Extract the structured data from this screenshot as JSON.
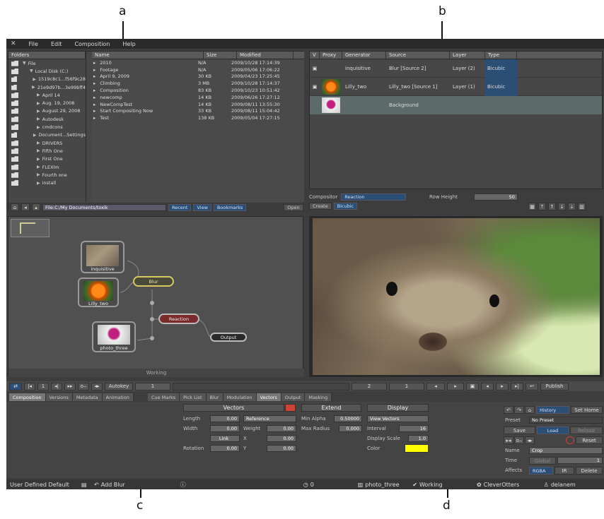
{
  "callouts": {
    "a": "a",
    "b": "b",
    "c": "c",
    "d": "d"
  },
  "menu": [
    "File",
    "Edit",
    "Composition",
    "Help"
  ],
  "browser": {
    "folders_header": "Folders",
    "tree": [
      {
        "label": "File",
        "d": 0,
        "exp": true
      },
      {
        "label": "Local Disk (C:)",
        "d": 1,
        "exp": true
      },
      {
        "label": "1519c8c1...f56f9c28",
        "d": 2
      },
      {
        "label": "21e9d97b...3e99bff4",
        "d": 2
      },
      {
        "label": "April 14",
        "d": 2
      },
      {
        "label": "Aug. 19, 2008",
        "d": 2
      },
      {
        "label": "August 29, 2008",
        "d": 2
      },
      {
        "label": "Autodesk",
        "d": 2
      },
      {
        "label": "cmdcons",
        "d": 2
      },
      {
        "label": "Document...Settings",
        "d": 2
      },
      {
        "label": "DRIVERS",
        "d": 2
      },
      {
        "label": "Fifth One",
        "d": 2
      },
      {
        "label": "First One",
        "d": 2
      },
      {
        "label": "FLEXlm",
        "d": 2
      },
      {
        "label": "Fourth one",
        "d": 2
      },
      {
        "label": "install",
        "d": 2
      }
    ],
    "cols": [
      "Name",
      "Size",
      "Modified"
    ],
    "files": [
      {
        "name": "2010",
        "size": "N/A",
        "mod": "2009/10/28 17:14:39"
      },
      {
        "name": "Footage",
        "size": "N/A",
        "mod": "2009/05/06 17:06:22"
      },
      {
        "name": "April 9, 2009",
        "size": "30 KB",
        "mod": "2009/04/23 17:25:45"
      },
      {
        "name": "Climbing",
        "size": "3 MB",
        "mod": "2009/10/28 17:14:37"
      },
      {
        "name": "Composition",
        "size": "83 KB",
        "mod": "2009/10/23 10:51:42"
      },
      {
        "name": "newcomp",
        "size": "14 KB",
        "mod": "2009/06/26 17:27:12"
      },
      {
        "name": "NewCompTest",
        "size": "14 KB",
        "mod": "2009/08/11 13:55:30"
      },
      {
        "name": "Start Compositing Now",
        "size": "33 KB",
        "mod": "2009/08/11 15:04:42"
      },
      {
        "name": "Test",
        "size": "138 KB",
        "mod": "2009/05/04 17:27:15"
      }
    ],
    "path": "File:C:/My Documents/toxik",
    "recent": "Recent",
    "view": "View",
    "bookmarks": "Bookmarks",
    "open": "Open"
  },
  "layers": {
    "cols": [
      "V",
      "Proxy",
      "Generator",
      "Source",
      "Layer",
      "Type"
    ],
    "rows": [
      {
        "gen": "inquisitive",
        "src": "Blur [Source 2]",
        "layer": "Layer (2)",
        "type": "Bicubic"
      },
      {
        "gen": "Lilly_two",
        "src": "Lilly_two [Source 1]",
        "layer": "Layer (1)",
        "type": "Bicubic"
      },
      {
        "gen": "",
        "src": "Background",
        "layer": "",
        "type": ""
      }
    ],
    "compositor_label": "Compositor",
    "compositor_value": "Reaction",
    "rowheight_label": "Row Height",
    "rowheight_value": "50",
    "create": "Create",
    "bicubic": "Bicubic"
  },
  "schematic": {
    "nodes": {
      "inq": "inquisitive",
      "lilly": "Lilly_two",
      "photo": "photo_three",
      "blur": "Blur",
      "reaction": "Reaction",
      "output": "Output"
    },
    "status": "Working"
  },
  "transport": {
    "autokey": "Autokey",
    "frame": "1",
    "f2": "2",
    "f3": "1",
    "publish": "Publish"
  },
  "tabs_left": [
    "Composition",
    "Versions",
    "Metadata",
    "Animation"
  ],
  "tabs_right": [
    "Cue Marks",
    "Pick List",
    "Blur",
    "Modulation",
    "Vectors",
    "Output",
    "Masking"
  ],
  "vectors": {
    "title": "Vectors",
    "extend": "Extend",
    "display": "Display",
    "length": "Length",
    "length_v": "0.00",
    "reference": "Reference",
    "width": "Width",
    "width_v": "0.00",
    "weight": "Weight",
    "weight_v": "0.00",
    "link": "Link",
    "x": "X",
    "x_v": "0.00",
    "rotation": "Rotation",
    "rotation_v": "0.00",
    "y": "Y",
    "y_v": "0.00",
    "min_alpha": "Min Alpha",
    "min_alpha_v": "0.50000",
    "max_radius": "Max Radius",
    "max_radius_v": "0.000",
    "view_vectors": "View Vectors",
    "interval": "Interval",
    "interval_v": "16",
    "display_scale": "Display Scale",
    "display_scale_v": "1.0",
    "color": "Color",
    "color_hex": "#ffff00"
  },
  "history": {
    "history": "History",
    "set_home": "Set Home",
    "preset": "Preset",
    "preset_v": "No Preset",
    "save": "Save",
    "load": "Load",
    "reload": "Reload",
    "reset": "Reset",
    "name": "Name",
    "name_v": "Crop",
    "time": "Time",
    "global": "Global",
    "time_v": "1",
    "affects": "Affects",
    "rgba": "RGBA",
    "ir": "IR",
    "delete": "Delete"
  },
  "status": {
    "default": "User Defined Default",
    "add": "Add Blur",
    "count": "0",
    "node": "photo_three",
    "working": "Working",
    "company": "CleverOtters",
    "user": "delanem"
  }
}
